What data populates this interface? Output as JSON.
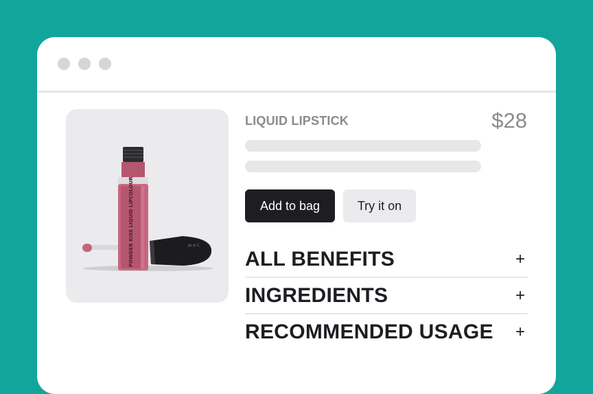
{
  "product": {
    "category": "LIQUID LIPSTICK",
    "price": "$28",
    "image_icon": "lipstick-image",
    "bottle_print": "POWDER KISS LIQUID LIPCOLOUR",
    "cap_print": "M·A·C"
  },
  "actions": {
    "add_to_bag": "Add to bag",
    "try_on": "Try it on"
  },
  "accordion": [
    {
      "label": "ALL BENEFITS",
      "icon": "+"
    },
    {
      "label": "INGREDIENTS",
      "icon": "+"
    },
    {
      "label": "RECOMMENDED USAGE",
      "icon": "+"
    }
  ],
  "colors": {
    "background": "#12a59c",
    "primary_button": "#1d1d22",
    "lipstick": "#b5566e"
  }
}
